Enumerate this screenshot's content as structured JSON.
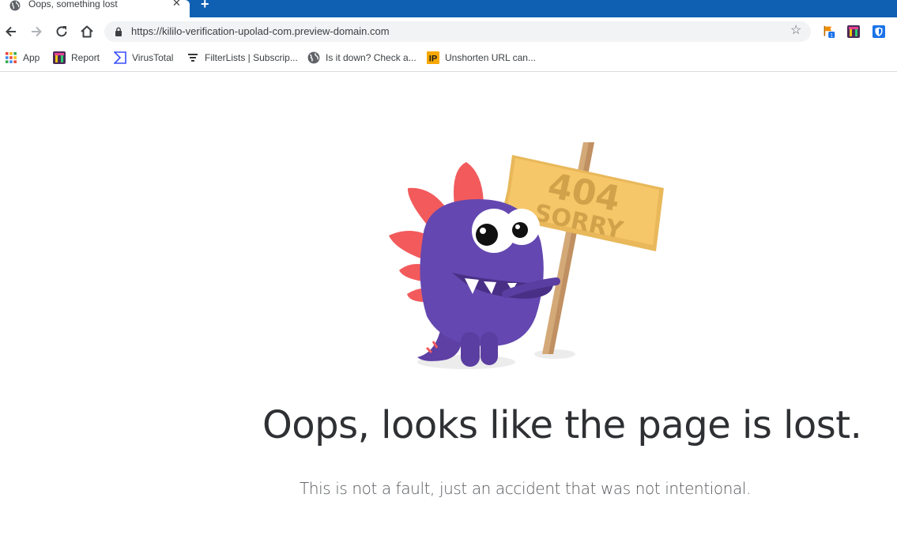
{
  "browser": {
    "tab": {
      "title": "Oops, something lost",
      "favicon": "globe-icon",
      "close_icon": "close-icon"
    },
    "new_tab_icon": "plus-icon",
    "accent_color": "#0f5fb3"
  },
  "toolbar": {
    "back_icon": "arrow-left-icon",
    "forward_icon": "arrow-right-icon",
    "reload_icon": "reload-icon",
    "home_icon": "home-icon",
    "url": "https://kililo-verification-upolad-com.preview-domain.com",
    "lock_icon": "lock-icon",
    "bookmark_star_icon": "star-icon",
    "extensions": [
      {
        "name": "flag-extension-icon",
        "badge": "1"
      },
      {
        "name": "report-extension-icon"
      },
      {
        "name": "shield-extension-icon"
      }
    ]
  },
  "bookmarks": [
    {
      "label": "App",
      "icon": "apps-grid-icon"
    },
    {
      "label": "Report",
      "icon": "report-icon"
    },
    {
      "label": "VirusTotal",
      "icon": "virustotal-icon"
    },
    {
      "label": "FilterLists | Subscrip...",
      "icon": "filter-icon"
    },
    {
      "label": "Is it down? Check a...",
      "icon": "globe-icon"
    },
    {
      "label": "Unshorten URL can...",
      "icon": "ip-icon"
    }
  ],
  "page": {
    "sign_code": "404",
    "sign_text": "SORRY",
    "headline": "Oops, looks like the page is lost.",
    "subline": "This is not a fault, just an accident that was not intentional.",
    "mascot": "purple-dinosaur-illustration"
  }
}
